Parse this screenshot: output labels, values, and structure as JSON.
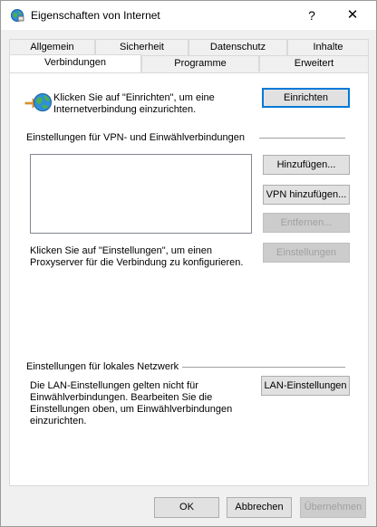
{
  "window": {
    "title": "Eigenschaften von Internet",
    "help_label": "?",
    "close_label": "✕"
  },
  "tabs": {
    "row1": [
      "Allgemein",
      "Sicherheit",
      "Datenschutz",
      "Inhalte"
    ],
    "row2": [
      "Verbindungen",
      "Programme",
      "Erweitert"
    ],
    "active": "Verbindungen"
  },
  "setup": {
    "text": "Klicken Sie auf \"Einrichten\", um eine\nInternetverbindung einzurichten.",
    "button": "Einrichten"
  },
  "vpn": {
    "group_label": "Einstellungen für VPN- und Einwählverbindungen",
    "add_button": "Hinzufügen...",
    "add_vpn_button": "VPN hinzufügen...",
    "remove_button": "Entfernen...",
    "settings_button": "Einstellungen",
    "proxy_text": "Klicken Sie auf \"Einstellungen\", um einen\nProxyserver für die Verbindung zu konfigurieren."
  },
  "lan": {
    "group_label": "Einstellungen für lokales Netzwerk",
    "text": "Die LAN-Einstellungen gelten nicht für\nEinwählverbindungen. Bearbeiten Sie die\nEinstellungen oben, um Einwählverbindungen\neinzurichten.",
    "button": "LAN-Einstellungen"
  },
  "footer": {
    "ok": "OK",
    "cancel": "Abbrechen",
    "apply": "Übernehmen"
  },
  "icons": {
    "title": "internet-options-globe-icon",
    "setup": "globe-connect-icon"
  }
}
